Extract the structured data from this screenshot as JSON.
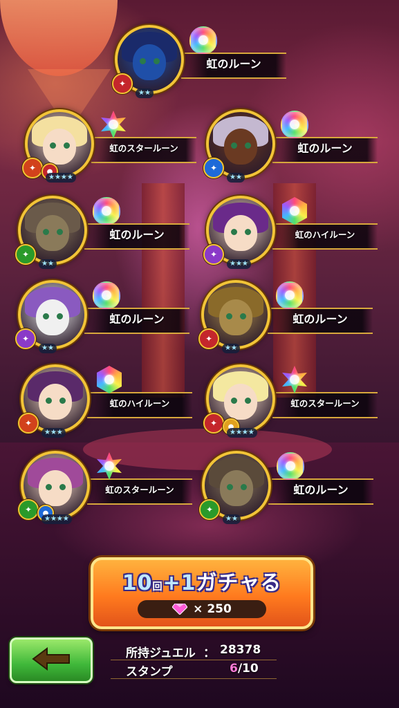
{
  "results": [
    {
      "label": "虹のルーン",
      "rune": "drop",
      "stars": "★★",
      "elem_color": "#c4262c",
      "elem2_color": "",
      "hair": "#1a2a6a",
      "skin": "#1f4fa8"
    },
    {
      "label": "虹のスタールーン",
      "rune": "star",
      "stars": "★★★★",
      "elem_color": "#d2421c",
      "elem2_color": "#c4262c",
      "hair": "#f4e0a0",
      "skin": "#f6dcc6"
    },
    {
      "label": "虹のルーン",
      "rune": "drop",
      "stars": "★★",
      "elem_color": "#1e6ad8",
      "elem2_color": "",
      "hair": "#c4b8d0",
      "skin": "#6a3a22"
    },
    {
      "label": "虹のルーン",
      "rune": "drop",
      "stars": "★★",
      "elem_color": "#2a9a2a",
      "elem2_color": "",
      "hair": "#6a5a4a",
      "skin": "#8a7a5a"
    },
    {
      "label": "虹のハイルーン",
      "rune": "hex",
      "stars": "★★★",
      "elem_color": "#8a3ac8",
      "elem2_color": "",
      "hair": "#6a2a8a",
      "skin": "#f6dcc6"
    },
    {
      "label": "虹のルーン",
      "rune": "drop",
      "stars": "★★",
      "elem_color": "#8a3ac8",
      "elem2_color": "",
      "hair": "#8a5ac0",
      "skin": "#f0f0f0"
    },
    {
      "label": "虹のルーン",
      "rune": "drop",
      "stars": "★★",
      "elem_color": "#c4262c",
      "elem2_color": "",
      "hair": "#8a6a2a",
      "skin": "#a88a4a"
    },
    {
      "label": "虹のハイルーン",
      "rune": "hex",
      "stars": "★★★",
      "elem_color": "#d2421c",
      "elem2_color": "",
      "hair": "#5a2a6a",
      "skin": "#f6dcc6"
    },
    {
      "label": "虹のスタールーン",
      "rune": "star",
      "stars": "★★★★",
      "elem_color": "#c4262c",
      "elem2_color": "#e0a020",
      "hair": "#f4e8a0",
      "skin": "#f6dcc6"
    },
    {
      "label": "虹のスタールーン",
      "rune": "star",
      "stars": "★★★★",
      "elem_color": "#2a9a2a",
      "elem2_color": "#1e6ad8",
      "hair": "#a04a9a",
      "skin": "#f6dcc6"
    },
    {
      "label": "虹のルーン",
      "rune": "drop",
      "stars": "★★",
      "elem_color": "#2a9a2a",
      "elem2_color": "",
      "hair": "#5a4a3a",
      "skin": "#8a7a5a"
    }
  ],
  "gacha": {
    "count": "10",
    "count_suffix": "回",
    "plus": "+1",
    "action": "ガチャる",
    "gem_cost": "× 250",
    "gem_color": "#ff5ad8"
  },
  "stats": {
    "jewel_label": "所持ジュエル",
    "jewel_sep": "：",
    "jewel_value": "28378",
    "stamp_label": "スタンプ",
    "stamp_current": "6",
    "stamp_total": "/10"
  },
  "back_button": {
    "icon": "arrow-left-icon",
    "color": "#5a3a10"
  }
}
